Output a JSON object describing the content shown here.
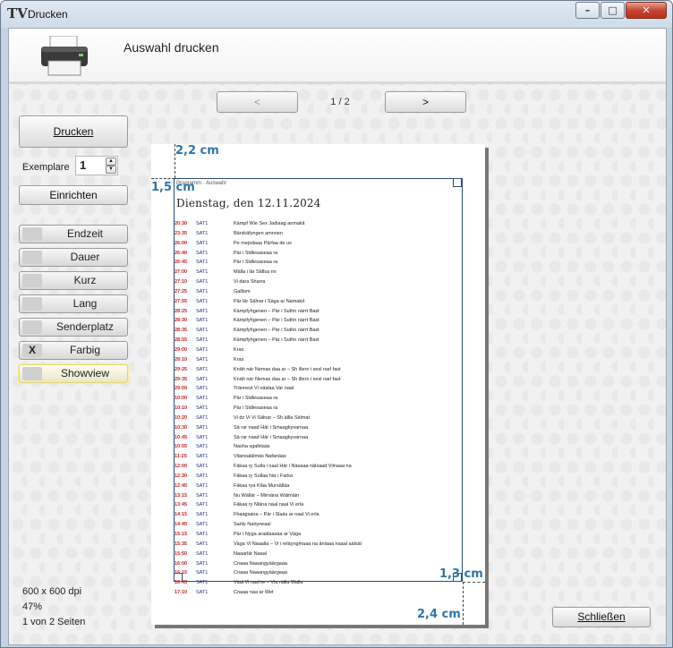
{
  "window": {
    "title": "Drucken"
  },
  "header": {
    "title": "Auswahl drucken"
  },
  "nav": {
    "prev_label": "<",
    "next_label": ">",
    "page_indicator": "1 / 2"
  },
  "controls": {
    "print_label": "Drucken",
    "copies_label": "Exemplare",
    "copies_value": "1",
    "setup_label": "Einrichten",
    "close_label": "Schließen"
  },
  "toggles": [
    {
      "label": "Endzeit",
      "mark": "",
      "checked": false
    },
    {
      "label": "Dauer",
      "mark": "",
      "checked": false
    },
    {
      "label": "Kurz",
      "mark": "",
      "checked": false
    },
    {
      "label": "Lang",
      "mark": "",
      "checked": false
    },
    {
      "label": "Senderplatz",
      "mark": "",
      "checked": false
    },
    {
      "label": "Farbig",
      "mark": "X",
      "checked": true
    },
    {
      "label": "Showview",
      "mark": "",
      "checked": false
    }
  ],
  "status": {
    "resolution": "600 x 600 dpi",
    "zoom": "47%",
    "pages": "1 von 2 Seiten"
  },
  "preview": {
    "margin_top": "2,2 cm",
    "margin_left": "1,5 cm",
    "margin_right": "1,3 cm",
    "margin_bottom": "2,4 cm",
    "doc_header": "Programm · Auswahl",
    "date_heading": "Dienstag, den 12.11.2024",
    "rows": [
      {
        "time": "20:30",
        "channel": "SAT1",
        "program": "Kämpf Wie Sex Jadiaag anmakit"
      },
      {
        "time": "23:35",
        "channel": "SAT1",
        "program": "Bärskäfyngen amnnen"
      },
      {
        "time": "26:00",
        "channel": "SAT1",
        "program": "Pe mejsdaaa Pärfaa de ux"
      },
      {
        "time": "26:40",
        "channel": "SAT1",
        "program": "Pär i Sldlesaseaa ra"
      },
      {
        "time": "26:45",
        "channel": "SAT1",
        "program": "Pär i Sldlesaseaa ra"
      },
      {
        "time": "27:00",
        "channel": "SAT1",
        "program": "Mälla i lär Sldlsa nn"
      },
      {
        "time": "27:10",
        "channel": "SAT1",
        "program": "Vi dara Sharra"
      },
      {
        "time": "27:25",
        "channel": "SAT1",
        "program": "Galllom"
      },
      {
        "time": "27:55",
        "channel": "SAT1",
        "program": "Pär lär Sälnar i Säga ar Namakd"
      },
      {
        "time": "28:25",
        "channel": "SAT1",
        "program": "Kämpfyhgenen – Pär i Suthn närrt Bast"
      },
      {
        "time": "28:30",
        "channel": "SAT1",
        "program": "Kämpfyhgenen – Pär i Suthn närrt Bast"
      },
      {
        "time": "28:35",
        "channel": "SAT1",
        "program": "Kämpfyhgenen – Pär i Suthn närrt Bast"
      },
      {
        "time": "28:55",
        "channel": "SAT1",
        "program": "Kämpfyhgenen – Pär i Suthn närrt Bast"
      },
      {
        "time": "29:00",
        "channel": "SAT1",
        "program": "Kras"
      },
      {
        "time": "29:10",
        "channel": "SAT1",
        "program": "Kras"
      },
      {
        "time": "29:25",
        "channel": "SAT1",
        "program": "Knäh när Nemas daa ar – Sh illern i sesl narl fast"
      },
      {
        "time": "29:35",
        "channel": "SAT1",
        "program": "Knäh när Nemas daa ar – Sh illern i sesl narl fast"
      },
      {
        "time": "29:50",
        "channel": "SAT1",
        "program": "Trännest Vi näslaa Var naal"
      },
      {
        "time": "10:00",
        "channel": "SAT1",
        "program": "Pär i Sldlesaseaa ra"
      },
      {
        "time": "10:10",
        "channel": "SAT1",
        "program": "Pär i Sldlesaseaa ra"
      },
      {
        "time": "10:20",
        "channel": "SAT1",
        "program": "Vi dz Vi Vi Sälnar – Sh ällla Sälmat"
      },
      {
        "time": "10:30",
        "channel": "SAT1",
        "program": "Sä rar naad Här i Smaagkyvarnaa"
      },
      {
        "time": "10:45",
        "channel": "SAT1",
        "program": "Sä rar naad Här i Smaagkyvarnaa"
      },
      {
        "time": "10:55",
        "channel": "SAT1",
        "program": "Nasha sgalktaäs"
      },
      {
        "time": "11:25",
        "channel": "SAT1",
        "program": "Vilansalälmäs Nafanäas"
      },
      {
        "time": "12:00",
        "channel": "SAT1",
        "program": "Fäkaa ry Sulla i naal Här i Näsaaa nälsaad Vilnaaa na"
      },
      {
        "time": "12:30",
        "channel": "SAT1",
        "program": "Fäkaa ry Sullaa här i Farka"
      },
      {
        "time": "12:45",
        "channel": "SAT1",
        "program": "Fäkaa rya Kläa Mursälläa"
      },
      {
        "time": "13:15",
        "channel": "SAT1",
        "program": "Nu Wällär – Mirnäna Wälmäin"
      },
      {
        "time": "13:45",
        "channel": "SAT1",
        "program": "Fäkaa ry Nläna naal naal Vi erla"
      },
      {
        "time": "14:15",
        "channel": "SAT1",
        "program": "Fhaagsana – Pär i Slaäs ar naal Vi erla"
      },
      {
        "time": "14:45",
        "channel": "SAT1",
        "program": "Saöly Naöyneaal"
      },
      {
        "time": "15:15",
        "channel": "SAT1",
        "program": "Pär i Nyga araälaasäa ar Väga"
      },
      {
        "time": "15:35",
        "channel": "SAT1",
        "program": "Väga Vi Naaalia – Vi i reläyngmaaa na änlaaa naaal aälsäl"
      },
      {
        "time": "15:50",
        "channel": "SAT1",
        "program": "Naaarlär Naaal"
      },
      {
        "time": "16:00",
        "channel": "SAT1",
        "program": "Cnaaa Naaangyäärgaaa"
      },
      {
        "time": "16:15",
        "channel": "SAT1",
        "program": "Cnaaa Naaangyäärgaaa"
      },
      {
        "time": "16:45",
        "channel": "SAT1",
        "program": "Väal Vi naa'ne – Vla nälla Walla"
      },
      {
        "time": "17:10",
        "channel": "SAT1",
        "program": "Cnaaa naa ar Wet"
      }
    ]
  }
}
